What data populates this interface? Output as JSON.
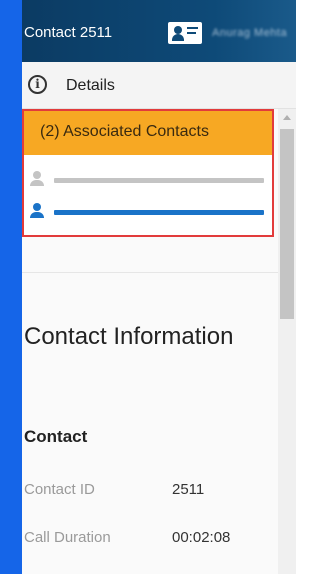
{
  "colors": {
    "left_strip": "#1565e8",
    "header_bg": "#0e4a78",
    "associated_header": "#f7a823",
    "highlight_border": "#e23b3b",
    "primary_blue": "#1a73c8",
    "muted_gray": "#c4c4c4"
  },
  "header": {
    "title": "Contact 2511",
    "icon": "contact-card-icon",
    "user_name": "Anurag Mehta"
  },
  "details": {
    "icon": "info-icon",
    "label": "Details"
  },
  "associated_contacts": {
    "label": "(2) Associated Contacts",
    "items": [
      {
        "icon": "person-icon",
        "state": "inactive"
      },
      {
        "icon": "person-icon",
        "state": "active"
      }
    ]
  },
  "contact_information": {
    "title": "Contact Information",
    "subsection": "Contact",
    "fields": [
      {
        "label": "Contact ID",
        "value": "2511"
      },
      {
        "label": "Call Duration",
        "value": "00:02:08"
      }
    ]
  }
}
